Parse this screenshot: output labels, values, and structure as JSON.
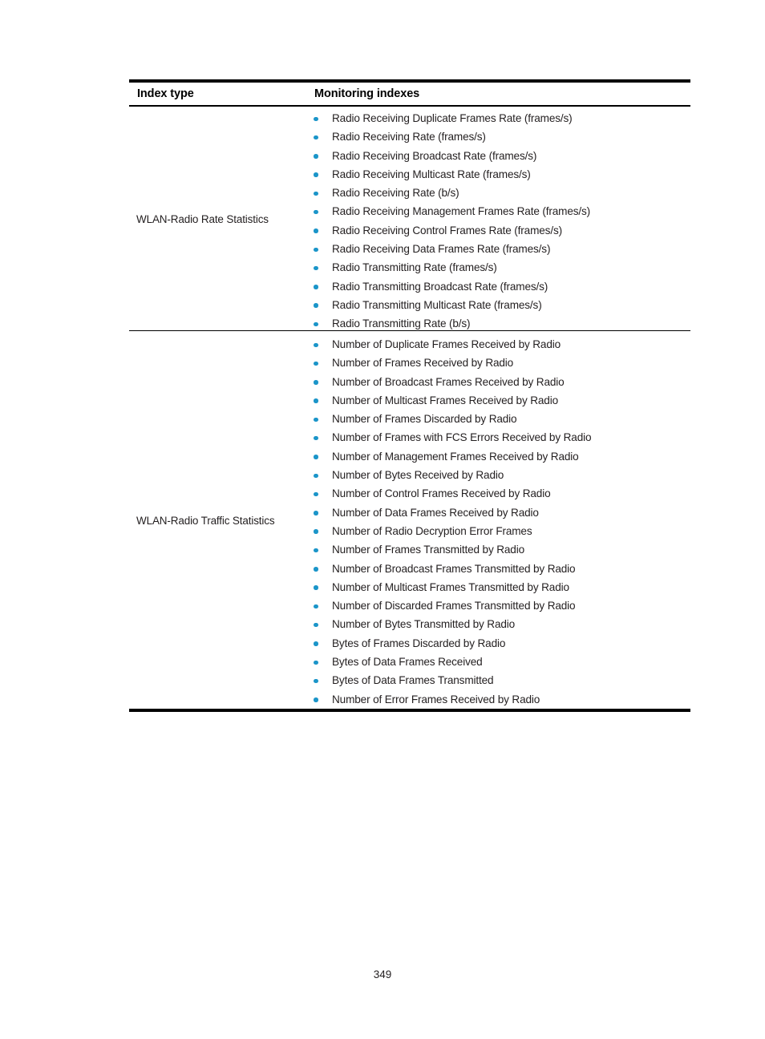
{
  "document": {
    "page_number": "349",
    "accent_bullet_color": "#1b95c9",
    "rule_color": "#000000",
    "text_color": "#231f20"
  },
  "table": {
    "headers": {
      "index_type": "Index type",
      "monitoring_indexes": "Monitoring indexes"
    },
    "rows": [
      {
        "index_type": "WLAN-Radio Rate Statistics",
        "monitoring_indexes": [
          "Radio Receiving Duplicate Frames Rate (frames/s)",
          "Radio Receiving Rate (frames/s)",
          "Radio Receiving Broadcast Rate (frames/s)",
          "Radio Receiving Multicast Rate (frames/s)",
          "Radio Receiving Rate (b/s)",
          "Radio Receiving Management Frames Rate (frames/s)",
          "Radio Receiving Control Frames Rate (frames/s)",
          "Radio Receiving Data Frames Rate (frames/s)",
          "Radio Transmitting Rate (frames/s)",
          "Radio Transmitting Broadcast Rate (frames/s)",
          "Radio Transmitting Multicast Rate (frames/s)",
          "Radio Transmitting Rate (b/s)"
        ]
      },
      {
        "index_type": "WLAN-Radio Traffic Statistics",
        "monitoring_indexes": [
          "Number of Duplicate Frames Received by Radio",
          "Number of Frames Received by Radio",
          "Number of Broadcast Frames Received by Radio",
          "Number of Multicast Frames Received by Radio",
          "Number of Frames Discarded by Radio",
          "Number of Frames with FCS Errors Received by Radio",
          "Number of Management Frames Received by Radio",
          "Number of Bytes Received by Radio",
          "Number of Control Frames Received by Radio",
          "Number of Data Frames Received by Radio",
          "Number of Radio Decryption Error Frames",
          "Number of Frames Transmitted by Radio",
          "Number of Broadcast Frames Transmitted by Radio",
          "Number of Multicast Frames Transmitted by Radio",
          "Number of Discarded Frames Transmitted by Radio",
          "Number of Bytes Transmitted by Radio",
          "Bytes of Frames Discarded by Radio",
          "Bytes of Data Frames Received",
          "Bytes of Data Frames Transmitted",
          "Number of Error Frames Received by Radio"
        ]
      }
    ]
  }
}
